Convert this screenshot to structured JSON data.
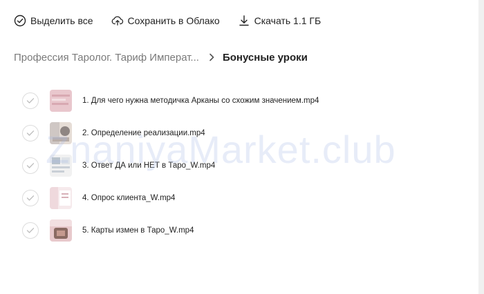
{
  "toolbar": {
    "select_all": "Выделить все",
    "save_cloud": "Сохранить в Облако",
    "download": "Скачать 1.1 ГБ"
  },
  "breadcrumb": {
    "parent": "Профессия Таролог. Тариф Императ...",
    "current": "Бонусные уроки"
  },
  "files": [
    {
      "name": "1. Для чего нужна методичка Арканы со схожим значением.mp4",
      "thumb_colors": [
        "#e9c7cd",
        "#d8a9b2",
        "#f3e0e3"
      ]
    },
    {
      "name": "2. Определение реализации.mp4",
      "thumb_colors": [
        "#cfc7c4",
        "#8f8683",
        "#e6ddd6"
      ]
    },
    {
      "name": "3. Ответ ДА или НЕТ в Таро_W.mp4",
      "thumb_colors": [
        "#dfe3e8",
        "#b9c3cc",
        "#f1f1f1"
      ]
    },
    {
      "name": "4. Опрос клиента_W.mp4",
      "thumb_colors": [
        "#efd9dd",
        "#d7b0b8",
        "#f6eaec"
      ]
    },
    {
      "name": "5. Карты измен в Таро_W.mp4",
      "thumb_colors": [
        "#e8c9cc",
        "#8a6a62",
        "#f2dfe1"
      ]
    }
  ],
  "watermark": "ZnaniyaMarket.club",
  "colors": {
    "accent_text": "#222222",
    "muted_text": "#7a7a7a",
    "watermark": "#aab9e6"
  }
}
